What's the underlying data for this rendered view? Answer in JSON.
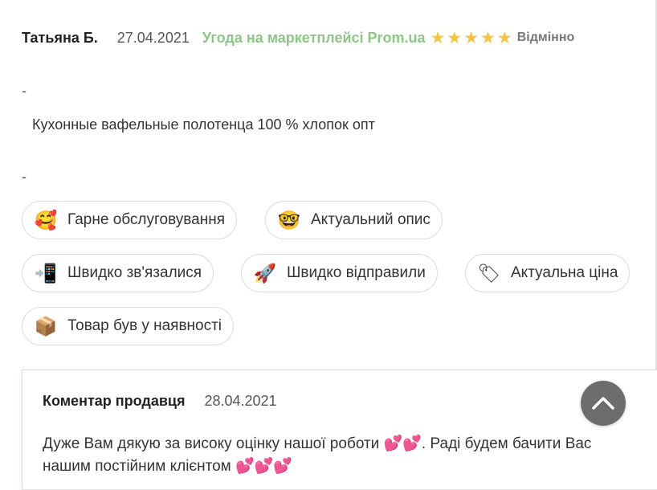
{
  "review": {
    "author": "Татьяна Б.",
    "date": "27.04.2021",
    "deal_label": "Угода на маркетплейсі Prom.ua",
    "rating": 5,
    "rating_text": "Відмінно",
    "separator_1": "-",
    "product": "Кухонные вафельные полотенца 100 % хлопок опт",
    "separator_2": "-",
    "star_color": "#f6c343",
    "deal_color": "#8dc785"
  },
  "tags": [
    {
      "label": "Гарне обслуговування",
      "icon": "smiling-face-with-hearts-icon",
      "glyph": "🥰"
    },
    {
      "label": "Актуальний опис",
      "icon": "nerd-face-icon",
      "glyph": "🤓"
    },
    {
      "label": "Швидко зв'язалися",
      "icon": "mobile-phone-arrow-icon",
      "glyph": "📲"
    },
    {
      "label": "Швидко відправили",
      "icon": "rocket-icon",
      "glyph": "🚀"
    },
    {
      "label": "Актуальна ціна",
      "icon": "price-tag-icon",
      "glyph": "🏷"
    },
    {
      "label": "Товар був у наявності",
      "icon": "package-icon",
      "glyph": "📦"
    }
  ],
  "seller_comment": {
    "title": "Коментар продавця",
    "date": "28.04.2021",
    "text_part1": "Дуже Вам дякую за високу оцінку нашої роботи ",
    "hearts_1": "💕💕",
    "text_part2": ". Раді будем бачити Вас нашим постійним клієнтом ",
    "hearts_2": "💕💕💕"
  },
  "scroll_top": {
    "icon": "chevron-up-icon",
    "color": "#6d6d6d"
  }
}
